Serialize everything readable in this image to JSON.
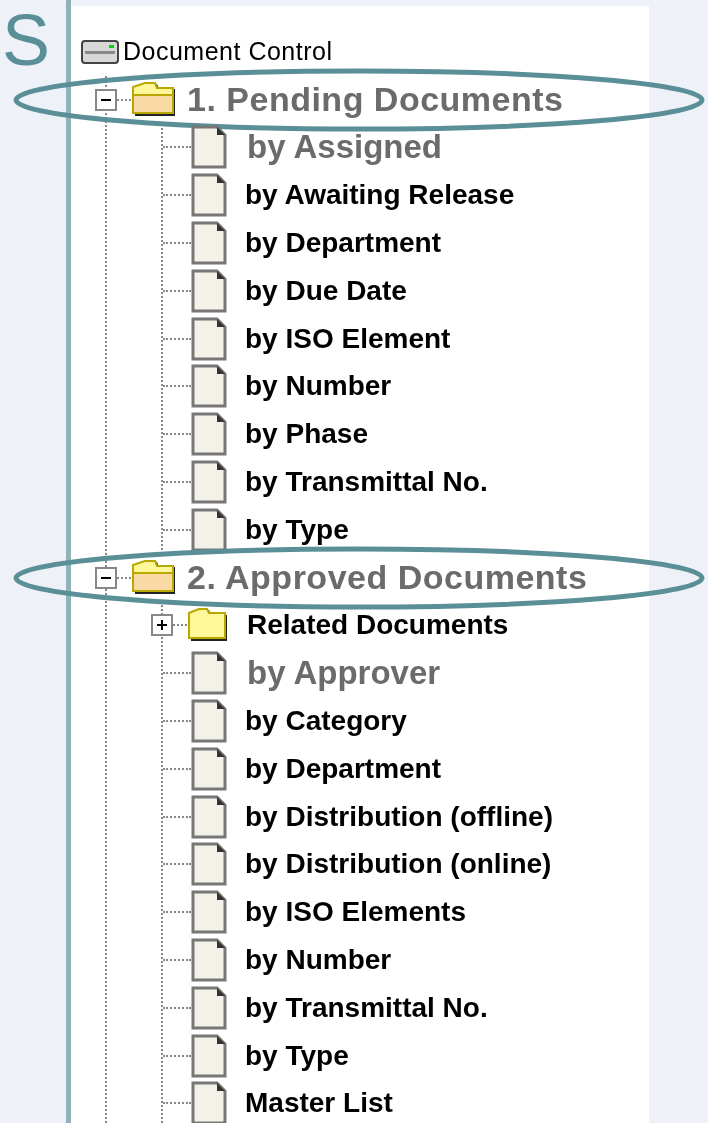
{
  "slide_title": "S",
  "tree": {
    "label": "Document Control",
    "groups": [
      {
        "label": "1. Pending Documents",
        "expanded": true,
        "highlighted": true,
        "children": [
          {
            "kind": "document",
            "label": "by Assigned",
            "greyed": true
          },
          {
            "kind": "document",
            "label": "by Awaiting Release",
            "greyed": false
          },
          {
            "kind": "document",
            "label": "by Department",
            "greyed": false
          },
          {
            "kind": "document",
            "label": "by Due Date",
            "greyed": false
          },
          {
            "kind": "document",
            "label": "by ISO Element",
            "greyed": false
          },
          {
            "kind": "document",
            "label": "by Number",
            "greyed": false
          },
          {
            "kind": "document",
            "label": "by Phase",
            "greyed": false
          },
          {
            "kind": "document",
            "label": "by Transmittal No.",
            "greyed": false
          },
          {
            "kind": "document",
            "label": "by Type",
            "greyed": false
          }
        ]
      },
      {
        "label": "2. Approved Documents",
        "expanded": true,
        "highlighted": true,
        "children": [
          {
            "kind": "folder",
            "label": "Related Documents",
            "greyed": false,
            "expanded": false
          },
          {
            "kind": "document",
            "label": "by Approver",
            "greyed": true
          },
          {
            "kind": "document",
            "label": "by Category",
            "greyed": false
          },
          {
            "kind": "document",
            "label": "by Department",
            "greyed": false
          },
          {
            "kind": "document",
            "label": "by Distribution (offline)",
            "greyed": false
          },
          {
            "kind": "document",
            "label": "by Distribution (online)",
            "greyed": false
          },
          {
            "kind": "document",
            "label": "by ISO Elements",
            "greyed": false
          },
          {
            "kind": "document",
            "label": "by Number",
            "greyed": false
          },
          {
            "kind": "document",
            "label": "by Transmittal No.",
            "greyed": false
          },
          {
            "kind": "document",
            "label": "by Type",
            "greyed": false
          },
          {
            "kind": "document",
            "label": "Master List",
            "greyed": false
          }
        ]
      }
    ]
  }
}
